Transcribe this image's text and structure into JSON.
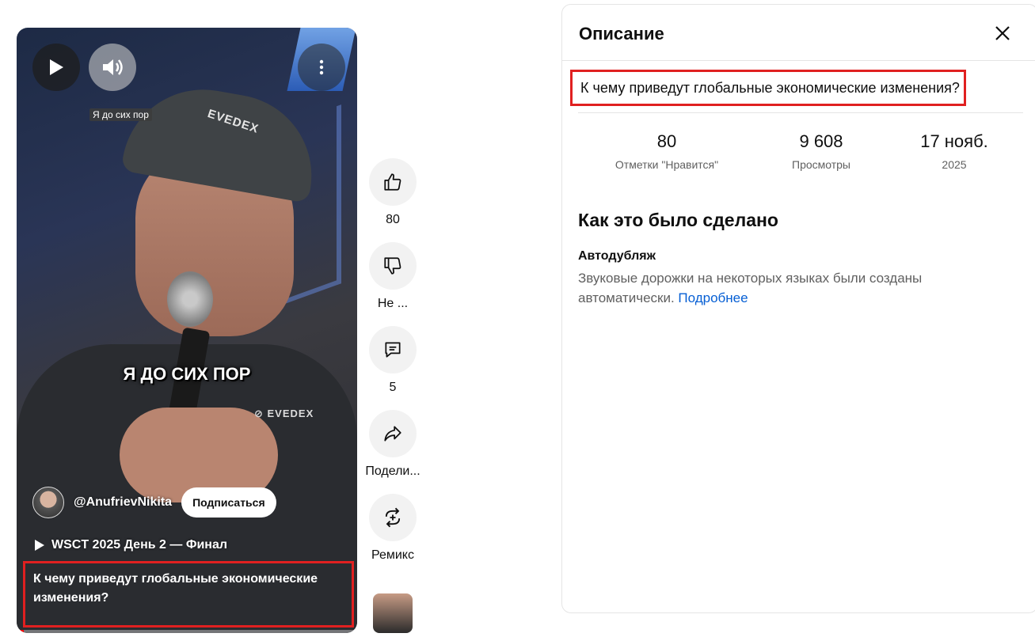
{
  "player": {
    "tooltip": "Я до сих пор",
    "overlay_caption": "Я ДО СИХ ПОР",
    "cap_logo": "EVEDEX",
    "shirt_logo": "⊘ EVEDEX",
    "channel_name": "@AnufrievNikita",
    "subscribe_label": "Подписаться",
    "playlist_label": "WSCT 2025 День 2 — Финал",
    "caption": "К чему приведут глобальные экономические изменения?",
    "progress_fraction": 0.02
  },
  "actions": {
    "like_count": "80",
    "dislike_label": "Не ...",
    "comments_count": "5",
    "share_label": "Подели...",
    "remix_label": "Ремикс"
  },
  "panel": {
    "title": "Описание",
    "description": "К чему приведут глобальные экономические изменения?",
    "stats": {
      "likes_value": "80",
      "likes_label": "Отметки \"Нравится\"",
      "views_value": "9 608",
      "views_label": "Просмотры",
      "date_value": "17 нояб.",
      "date_label": "2025"
    },
    "section_title": "Как это было сделано",
    "feature_title": "Автодубляж",
    "feature_text": "Звуковые дорожки на некоторых языках были созданы автоматически.",
    "feature_link": "Подробнее"
  },
  "colors": {
    "accent_red": "#e02020",
    "link_blue": "#065fd4",
    "muted_text": "#606060"
  }
}
